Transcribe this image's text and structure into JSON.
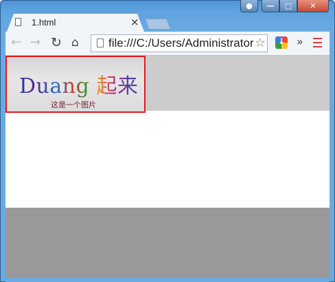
{
  "window": {
    "controls": [
      "user",
      "minimize",
      "maximize",
      "close"
    ]
  },
  "tab": {
    "title": "1.html",
    "close_label": "×"
  },
  "toolbar": {
    "back_icon": "←",
    "forward_icon": "→",
    "reload_icon": "↻",
    "home_icon": "⌂",
    "address": "file:///C:/Users/Administrator",
    "star_icon": "☆",
    "overflow_label": "»"
  },
  "page": {
    "image_text": "Duang 起来",
    "image_caption": "这是一个图片",
    "colors": {
      "header_bg": "#cccccc",
      "footer_bg": "#999999",
      "image_border": "#e11b1b"
    }
  }
}
